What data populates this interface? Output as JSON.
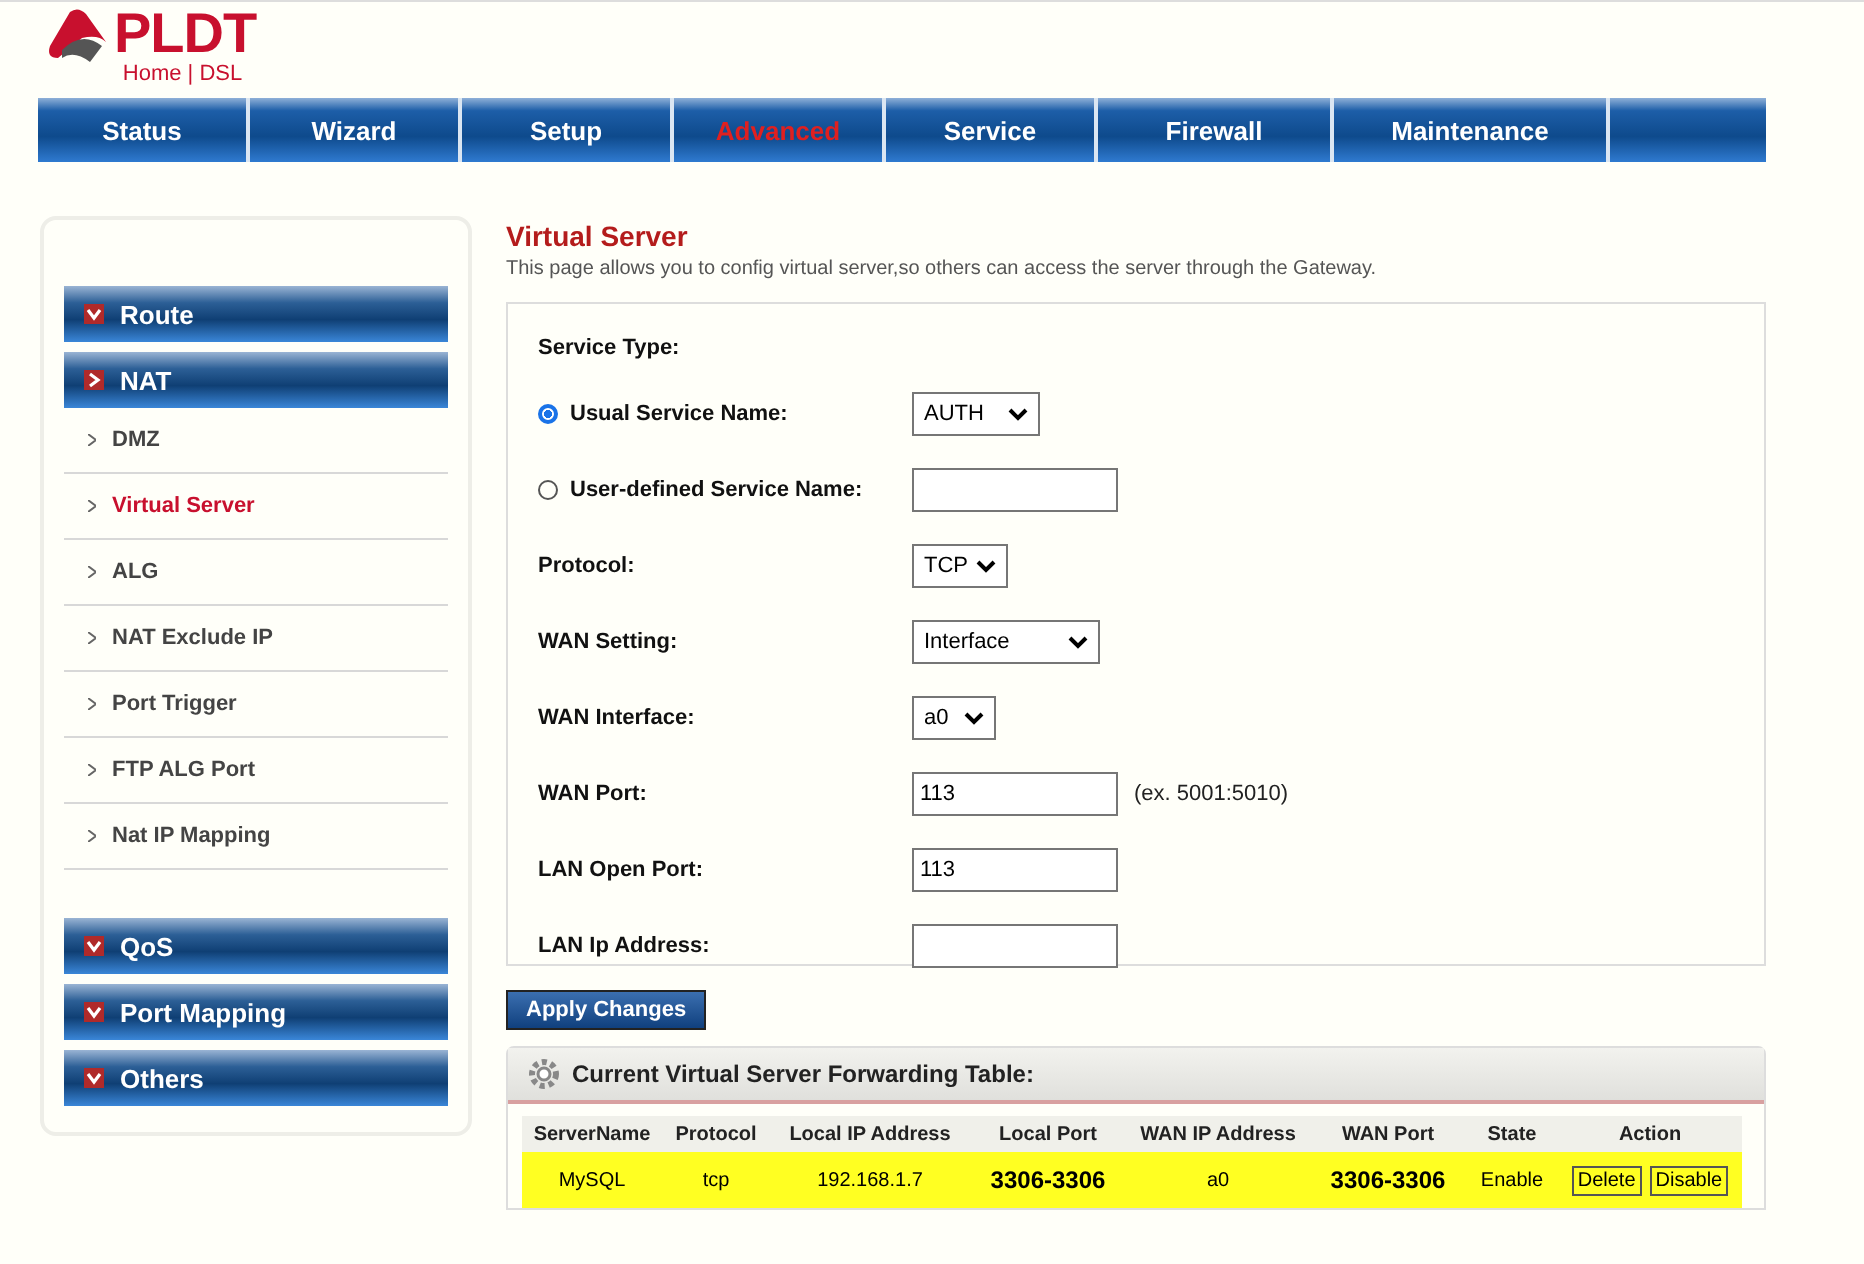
{
  "logo": {
    "brand": "PLDT",
    "sub": "Home | DSL"
  },
  "nav": [
    {
      "label": "Status",
      "selected": false
    },
    {
      "label": "Wizard",
      "selected": false
    },
    {
      "label": "Setup",
      "selected": false
    },
    {
      "label": "Advanced",
      "selected": true
    },
    {
      "label": "Service",
      "selected": false
    },
    {
      "label": "Firewall",
      "selected": false
    },
    {
      "label": "Maintenance",
      "selected": false
    }
  ],
  "sidebar": [
    {
      "label": "Route",
      "expanded": false
    },
    {
      "label": "NAT",
      "expanded": true,
      "children": [
        {
          "label": "DMZ",
          "selected": false
        },
        {
          "label": "Virtual Server",
          "selected": true
        },
        {
          "label": "ALG",
          "selected": false
        },
        {
          "label": "NAT Exclude IP",
          "selected": false
        },
        {
          "label": "Port Trigger",
          "selected": false
        },
        {
          "label": "FTP ALG Port",
          "selected": false
        },
        {
          "label": "Nat IP Mapping",
          "selected": false
        }
      ]
    },
    {
      "label": "QoS",
      "expanded": false
    },
    {
      "label": "Port Mapping",
      "expanded": false
    },
    {
      "label": "Others",
      "expanded": false
    }
  ],
  "page": {
    "title": "Virtual Server",
    "description": "This page allows you to config virtual server,so others can access the server through the Gateway."
  },
  "form": [
    {
      "kind": "heading",
      "label": "Service Type:"
    },
    {
      "kind": "radio-select",
      "label": "Usual Service Name:",
      "selected": true,
      "value": "AUTH"
    },
    {
      "kind": "radio-input",
      "label": "User-defined Service Name:",
      "selected": false
    },
    {
      "kind": "select",
      "label": "Protocol:",
      "value": "TCP"
    },
    {
      "kind": "select",
      "label": "WAN Setting:",
      "value": "Interface"
    },
    {
      "kind": "select",
      "label": "WAN Interface:",
      "value": "a0"
    },
    {
      "kind": "input",
      "label": "WAN Port:",
      "value": "113",
      "hint": "(ex. 5001:5010)"
    },
    {
      "kind": "input",
      "label": "LAN Open Port:",
      "value": "113"
    },
    {
      "kind": "input",
      "label": "LAN Ip Address:"
    }
  ],
  "apply_button": "Apply Changes",
  "table": {
    "title": "Current Virtual Server Forwarding Table:",
    "columns": [
      "ServerName",
      "Protocol",
      "Local IP Address",
      "Local Port",
      "WAN IP Address",
      "WAN Port",
      "State",
      "Action"
    ],
    "rows": [
      {
        "highlighted": true,
        "cells": [
          "MySQL",
          "tcp",
          "192.168.1.7",
          "3306-3306",
          "a0",
          "3306-3306",
          "Enable"
        ],
        "actions": [
          "Delete",
          "Disable"
        ]
      }
    ]
  }
}
